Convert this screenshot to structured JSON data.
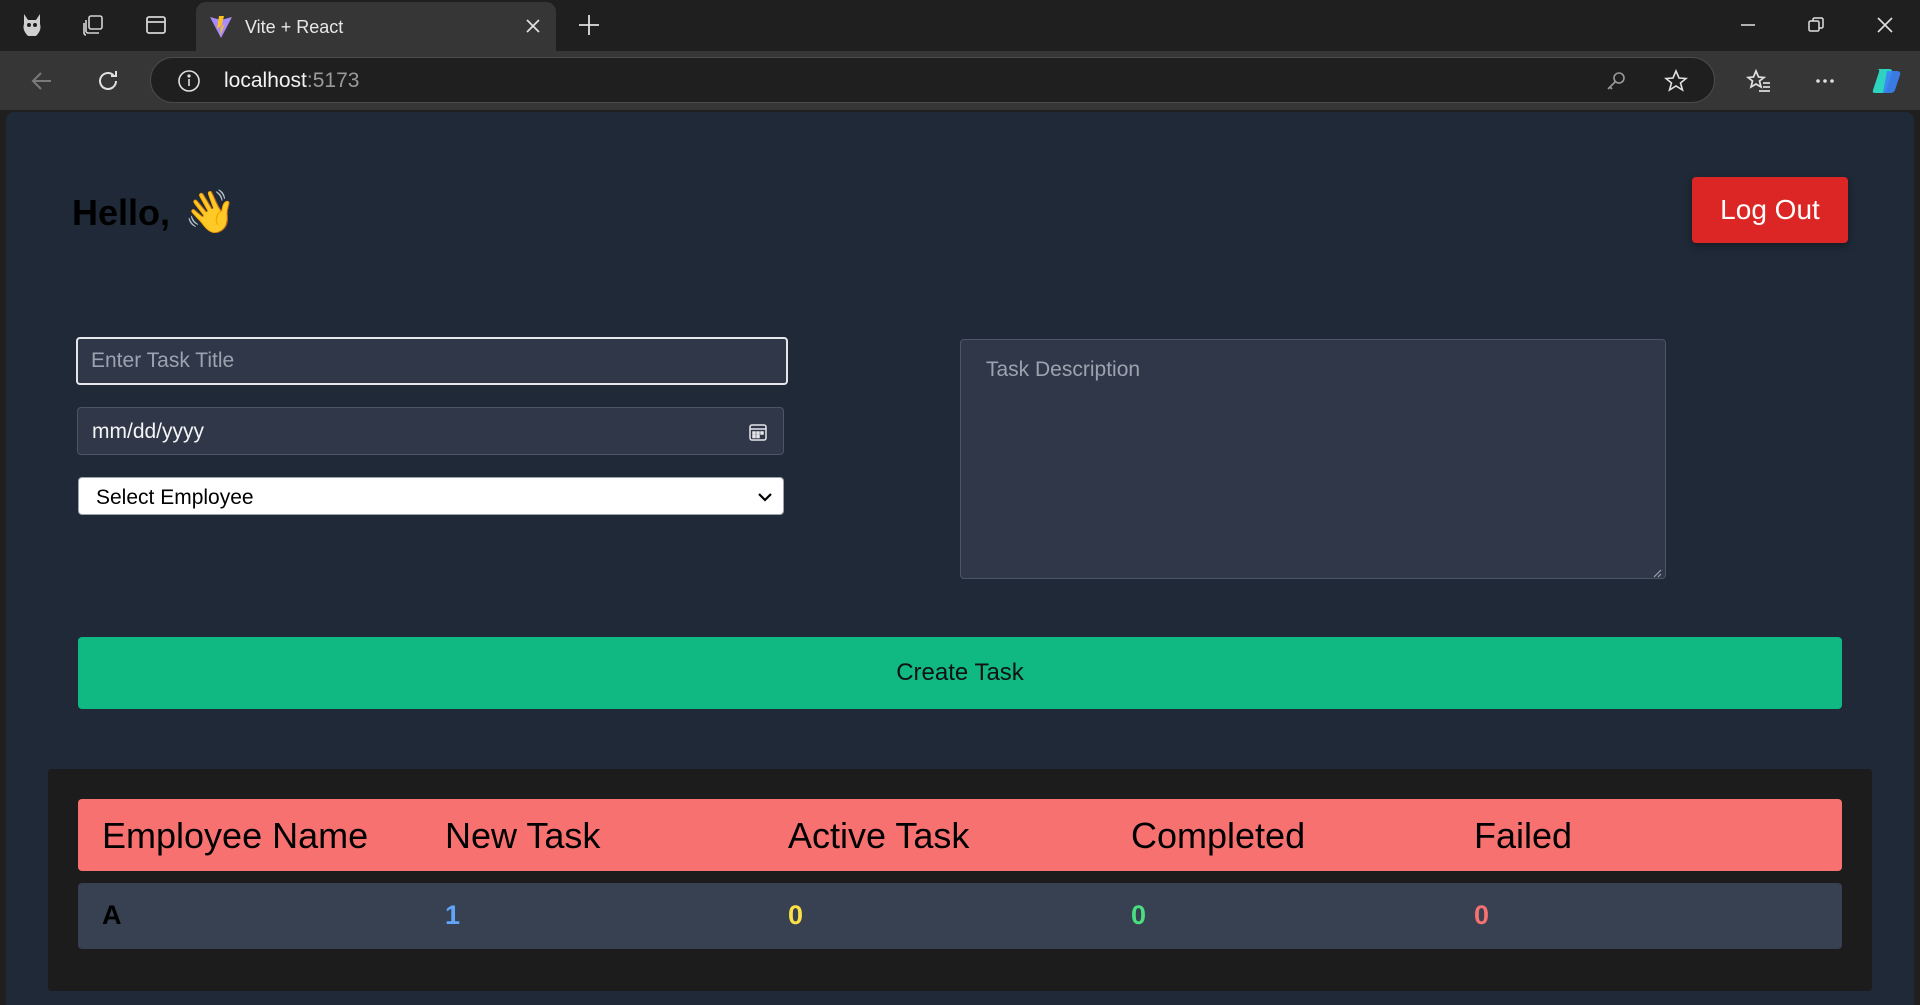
{
  "browser": {
    "tab_title": "Vite + React",
    "url_host": "localhost",
    "url_port": ":5173"
  },
  "page": {
    "greeting": "Hello,",
    "greeting_emoji": "👋",
    "logout_label": "Log Out",
    "task_title_placeholder": "Enter Task Title",
    "date_placeholder": "mm/dd/yyyy",
    "employee_select": "Select Employee",
    "description_placeholder": "Task Description",
    "create_label": "Create Task"
  },
  "table": {
    "headers": [
      "Employee Name",
      "New Task",
      "Active Task",
      "Completed",
      "Failed"
    ],
    "rows": [
      {
        "name": "A",
        "new": "1",
        "active": "0",
        "completed": "0",
        "failed": "0"
      }
    ]
  },
  "colors": {
    "page_bg": "#1f2937",
    "logout": "#dc2626",
    "create": "#10b981",
    "table_header": "#f87171",
    "new_task": "#60a5fa",
    "active_task": "#fde047",
    "completed": "#4ade80",
    "failed": "#f87171"
  }
}
